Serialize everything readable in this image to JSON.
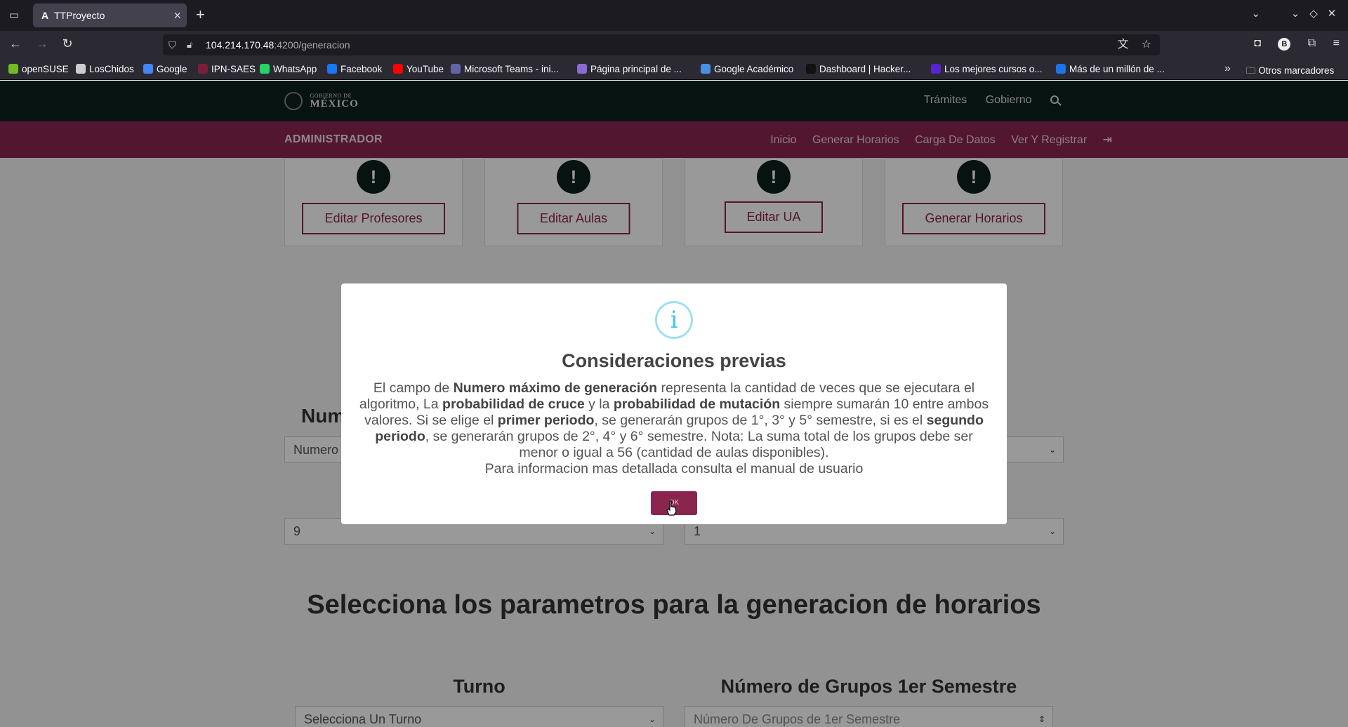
{
  "browser": {
    "tab_title": "TTProyecto",
    "url_host": "104.214.170.48",
    "url_path": ":4200/generacion",
    "bookmarks": [
      {
        "label": "openSUSE",
        "color": "#73ba25"
      },
      {
        "label": "LosChidos",
        "color": "#cccccc"
      },
      {
        "label": "Google",
        "color": "#4285f4"
      },
      {
        "label": "IPN-SAES",
        "color": "#7a1e3c"
      },
      {
        "label": "WhatsApp",
        "color": "#25d366"
      },
      {
        "label": "Facebook",
        "color": "#1877f2"
      },
      {
        "label": "YouTube",
        "color": "#ff0000"
      },
      {
        "label": "Microsoft Teams - ini...",
        "color": "#6264a7"
      },
      {
        "label": "Página principal de ...",
        "color": "#8a6bd4"
      },
      {
        "label": "Google Académico",
        "color": "#4a90e2"
      },
      {
        "label": "Dashboard | Hacker...",
        "color": "#111111"
      },
      {
        "label": "Los mejores cursos o...",
        "color": "#5624d0"
      },
      {
        "label": "Más de un millón de ...",
        "color": "#1a73e8"
      }
    ],
    "other_bookmarks": "Otros marcadores",
    "profile_initial": "B"
  },
  "gob": {
    "logo_small": "GOBIERNO DE",
    "logo_big": "MÉXICO",
    "links": [
      "Trámites",
      "Gobierno"
    ]
  },
  "admin": {
    "title": "ADMINISTRADOR",
    "links": [
      "Inicio",
      "Generar Horarios",
      "Carga De Datos",
      "Ver Y Registrar"
    ]
  },
  "cards": [
    {
      "button": "Editar Profesores"
    },
    {
      "button": "Editar Aulas"
    },
    {
      "button": "Editar UA"
    },
    {
      "button": "Generar Horarios"
    }
  ],
  "form": {
    "partial_label": "Num",
    "partial_placeholder": "Numero",
    "select_left_value": "9",
    "select_right_value": "1",
    "big_title": "Selecciona los parametros para la generacion de horarios",
    "turno_label": "Turno",
    "turno_placeholder": "Selecciona Un Turno",
    "grupos_label": "Número de Grupos 1er Semestre",
    "grupos_placeholder": "Número De Grupos de 1er Semestre"
  },
  "modal": {
    "title": "Consideraciones previas",
    "p1": "El campo de ",
    "b1": "Numero máximo de generación",
    "p2": " representa la cantidad de veces que se ejecutara el algoritmo, La ",
    "b2": "probabilidad de cruce",
    "p3": " y la ",
    "b3": "probabilidad de mutación",
    "p4": " siempre sumarán 10 entre ambos valores. Si se elige el ",
    "b4": "primer periodo",
    "p5": ", se generarán grupos de 1°, 3° y 5° semestre, si es el ",
    "b5": "segundo periodo",
    "p6": ", se generarán grupos de 2°, 4° y 6° semestre. Nota: La suma total de los grupos debe ser menor o igual a 56 (cantidad de aulas disponibles).",
    "p7": "Para informacion mas detallada consulta el manual de usuario",
    "ok_label": "OK"
  }
}
